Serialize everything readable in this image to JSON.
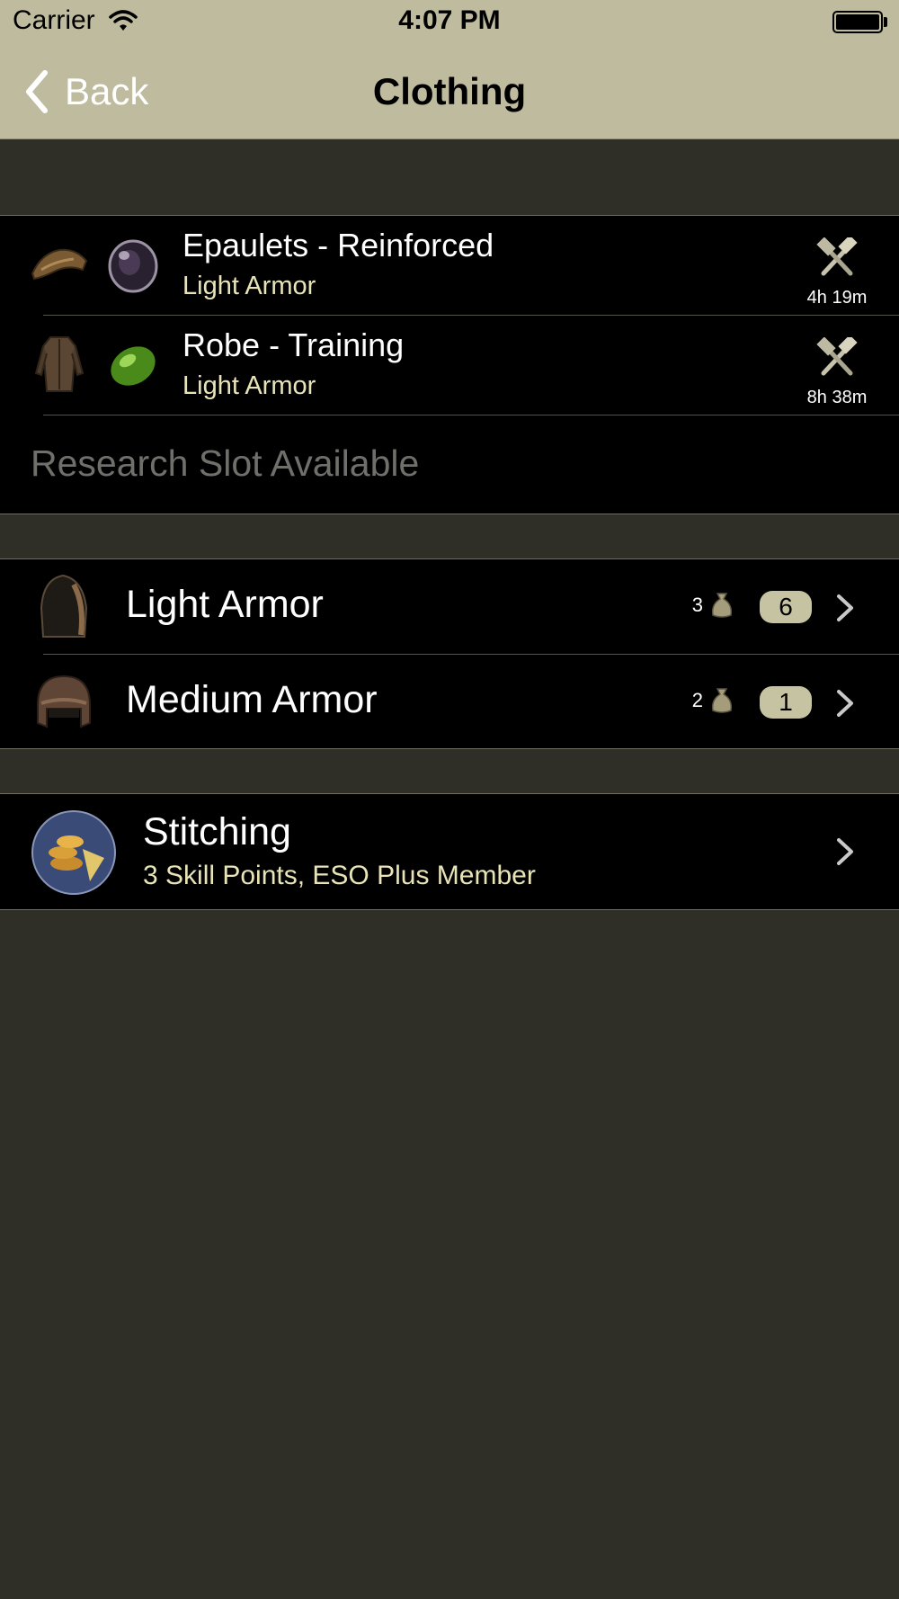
{
  "status_bar": {
    "carrier": "Carrier",
    "time": "4:07 PM"
  },
  "nav": {
    "back_label": "Back",
    "title": "Clothing"
  },
  "research": {
    "items": [
      {
        "name": "Epaulets - Reinforced",
        "type": "Light Armor",
        "time_left": "4h 19m",
        "item_icon": "epaulets-icon",
        "trait_icon": "trait-gem-icon"
      },
      {
        "name": "Robe - Training",
        "type": "Light Armor",
        "time_left": "8h 38m",
        "item_icon": "robe-icon",
        "trait_icon": "trait-gem-icon"
      }
    ],
    "slot_available": "Research Slot Available"
  },
  "categories": [
    {
      "label": "Light Armor",
      "count": "3",
      "badge": "6",
      "icon": "hood-icon"
    },
    {
      "label": "Medium Armor",
      "count": "2",
      "badge": "1",
      "icon": "helmet-icon"
    }
  ],
  "skill": {
    "title": "Stitching",
    "subtitle": "3 Skill Points, ESO Plus Member",
    "icon": "stitching-skill-icon"
  },
  "colors": {
    "nav_bar": "#bebb9e",
    "page_background": "#2f2f28",
    "cell_background": "#000000",
    "subtitle_text": "#e9e4b7",
    "badge": "#c6c3a2",
    "placeholder_text": "#6f6f6b"
  }
}
